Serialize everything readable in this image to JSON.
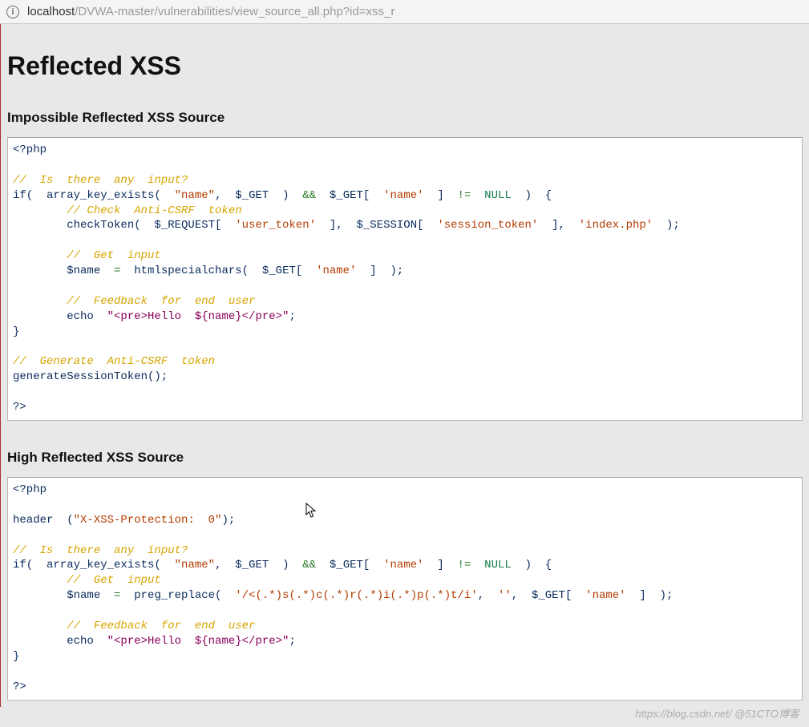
{
  "address_bar": {
    "host": "localhost",
    "path": "/DVWA-master/vulnerabilities/view_source_all.php?id=xss_r"
  },
  "page": {
    "title": "Reflected XSS",
    "sections": [
      {
        "heading": "Impossible Reflected XSS So",
        "heading_rest": "urce"
      },
      {
        "heading": "High Reflected XSS So",
        "heading_rest": "urce"
      }
    ]
  },
  "code": {
    "impossible": {
      "l01": "<?php",
      "l02": "",
      "l03_c": "//  Is  there  any  input?",
      "l04a": "if(  array_key_exists(  ",
      "l04s1": "\"name\"",
      "l04b": ",  $_GET  )  ",
      "l04op": "&&",
      "l04c": "  $_GET[  ",
      "l04s2": "'name'",
      "l04d": "  ]  ",
      "l04op2": "!=",
      "l04e": "  ",
      "l04null": "NULL",
      "l04f": "  )  {",
      "l05_c": "        // Check  Anti-CSRF  token",
      "l06a": "        checkToken(  $_REQUEST[  ",
      "l06s1": "'user_token'",
      "l06b": "  ],  $_SESSION[  ",
      "l06s2": "'session_token'",
      "l06c": "  ],  ",
      "l06s3": "'index.php'",
      "l06d": "  );",
      "l07": "",
      "l08_c": "        //  Get  input",
      "l09a": "        $name  ",
      "l09op": "=",
      "l09b": "  htmlspecialchars(  $_GET[  ",
      "l09s1": "'name'",
      "l09c": "  ]  );",
      "l10": "",
      "l11_c": "        //  Feedback  for  end  user",
      "l12a": "        echo  ",
      "l12s": "\"<pre>Hello  ${name}</pre>\"",
      "l12b": ";",
      "l13": "}",
      "l14": "",
      "l15_c": "//  Generate  Anti-CSRF  token",
      "l16": "generateSessionToken();",
      "l17": "",
      "l18": "?>"
    },
    "high": {
      "l01": "<?php",
      "l02": "",
      "l03a": "header  (",
      "l03s": "\"X-XSS-Protection:  0\"",
      "l03b": ");",
      "l04": "",
      "l05_c": "//  Is  there  any  input?",
      "l06a": "if(  array_key_exists(  ",
      "l06s1": "\"name\"",
      "l06b": ",  $_GET  )  ",
      "l06op": "&&",
      "l06c": "  $_GET[  ",
      "l06s2": "'name'",
      "l06d": "  ]  ",
      "l06op2": "!=",
      "l06e": "  ",
      "l06null": "NULL",
      "l06f": "  )  {",
      "l07_c": "        //  Get  input",
      "l08a": "        $name  ",
      "l08op": "=",
      "l08b": "  preg_replace(  ",
      "l08s1": "'/<(.*)s(.*)c(.*)r(.*)i(.*)p(.*)t/i'",
      "l08c": ",  ",
      "l08s2": "''",
      "l08d": ",  $_GET[  ",
      "l08s3": "'name'",
      "l08e": "  ]  );",
      "l09": "",
      "l10_c": "        //  Feedback  for  end  user",
      "l11a": "        echo  ",
      "l11s": "\"<pre>Hello  ${name}</pre>\"",
      "l11b": ";",
      "l12": "}",
      "l13": "",
      "l14": "?>"
    }
  },
  "watermark": "https://blog.csdn.net/  @51CTO博客"
}
